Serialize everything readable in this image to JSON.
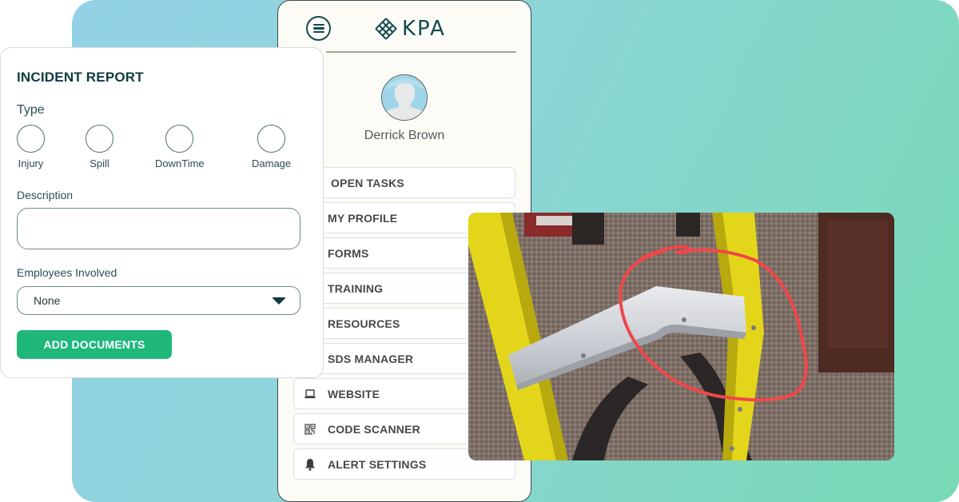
{
  "colors": {
    "brand_dark": "#124a4f",
    "accent_green": "#1fb87a",
    "annotation_red": "#f0474a",
    "ladder_yellow": "#e8d91a"
  },
  "phone": {
    "logo_text": "KPA",
    "user_name": "Derrick Brown",
    "nav_items": [
      {
        "label": "OPEN TASKS",
        "icon": "none"
      },
      {
        "label": "MY PROFILE",
        "icon": "none"
      },
      {
        "label": "FORMS",
        "icon": "none"
      },
      {
        "label": "TRAINING",
        "icon": "none"
      },
      {
        "label": "RESOURCES",
        "icon": "none"
      },
      {
        "label": "SDS MANAGER",
        "icon": "none"
      },
      {
        "label": "WEBSITE",
        "icon": "laptop-icon"
      },
      {
        "label": "CODE SCANNER",
        "icon": "qr-code-icon"
      },
      {
        "label": "ALERT SETTINGS",
        "icon": "bell-icon"
      }
    ]
  },
  "form": {
    "title": "INCIDENT REPORT",
    "type_label": "Type",
    "type_options": [
      "Injury",
      "Spill",
      "DownTime",
      "Damage"
    ],
    "description_label": "Description",
    "description_value": "",
    "employees_label": "Employees Involved",
    "employees_selected": "None",
    "add_documents_label": "ADD DOCUMENTS"
  },
  "photo": {
    "subject": "damaged ladder step",
    "annotation": "red circle around bent step"
  }
}
